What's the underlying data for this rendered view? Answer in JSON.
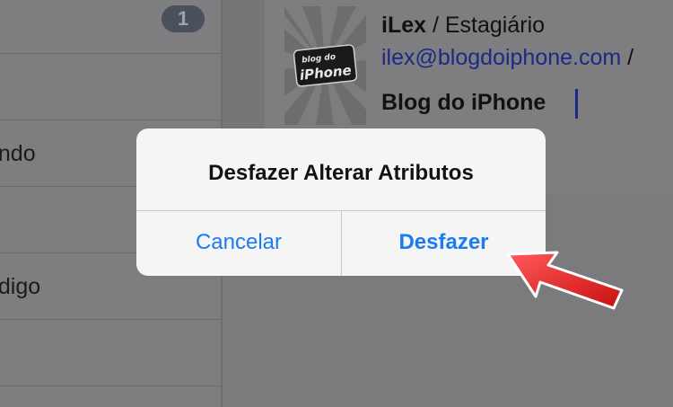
{
  "sidebar": {
    "badge_count": "1",
    "items": [
      {
        "label": ""
      },
      {
        "label": "undo"
      },
      {
        "label": ""
      },
      {
        "label": "ódigo"
      },
      {
        "label": ""
      }
    ]
  },
  "signature": {
    "name": "iLex",
    "separator": " / ",
    "role": "Estagiário",
    "email": "ilex@blogdoiphone.com",
    "email_suffix": " /",
    "blog": "Blog do iPhone",
    "logo_text_top": "blog do",
    "logo_text_bottom": "iPhone"
  },
  "alert": {
    "title": "Desfazer Alterar Atributos",
    "cancel_label": "Cancelar",
    "confirm_label": "Desfazer"
  },
  "colors": {
    "accent": "#1a7cf0",
    "annotation_arrow": "#e81e1e"
  }
}
